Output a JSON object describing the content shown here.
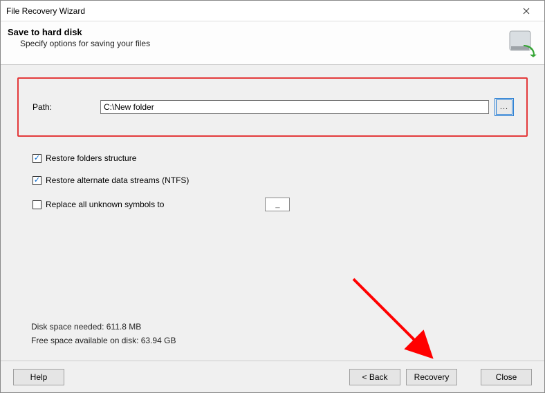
{
  "window": {
    "title": "File Recovery Wizard"
  },
  "header": {
    "title": "Save to hard disk",
    "subtitle": "Specify options for saving your files"
  },
  "path": {
    "label": "Path:",
    "value": "C:\\New folder",
    "browse_label": "..."
  },
  "options": {
    "restore_folders": {
      "label": "Restore folders structure",
      "checked": true
    },
    "restore_ads": {
      "label": "Restore alternate data streams (NTFS)",
      "checked": true
    },
    "replace_symbols": {
      "label": "Replace all unknown symbols to",
      "checked": false,
      "value": "_"
    }
  },
  "status": {
    "needed": "Disk space needed: 611.8 MB",
    "free": "Free space available on disk: 63.94 GB"
  },
  "footer": {
    "help": "Help",
    "back": "< Back",
    "recovery": "Recovery",
    "close": "Close"
  }
}
